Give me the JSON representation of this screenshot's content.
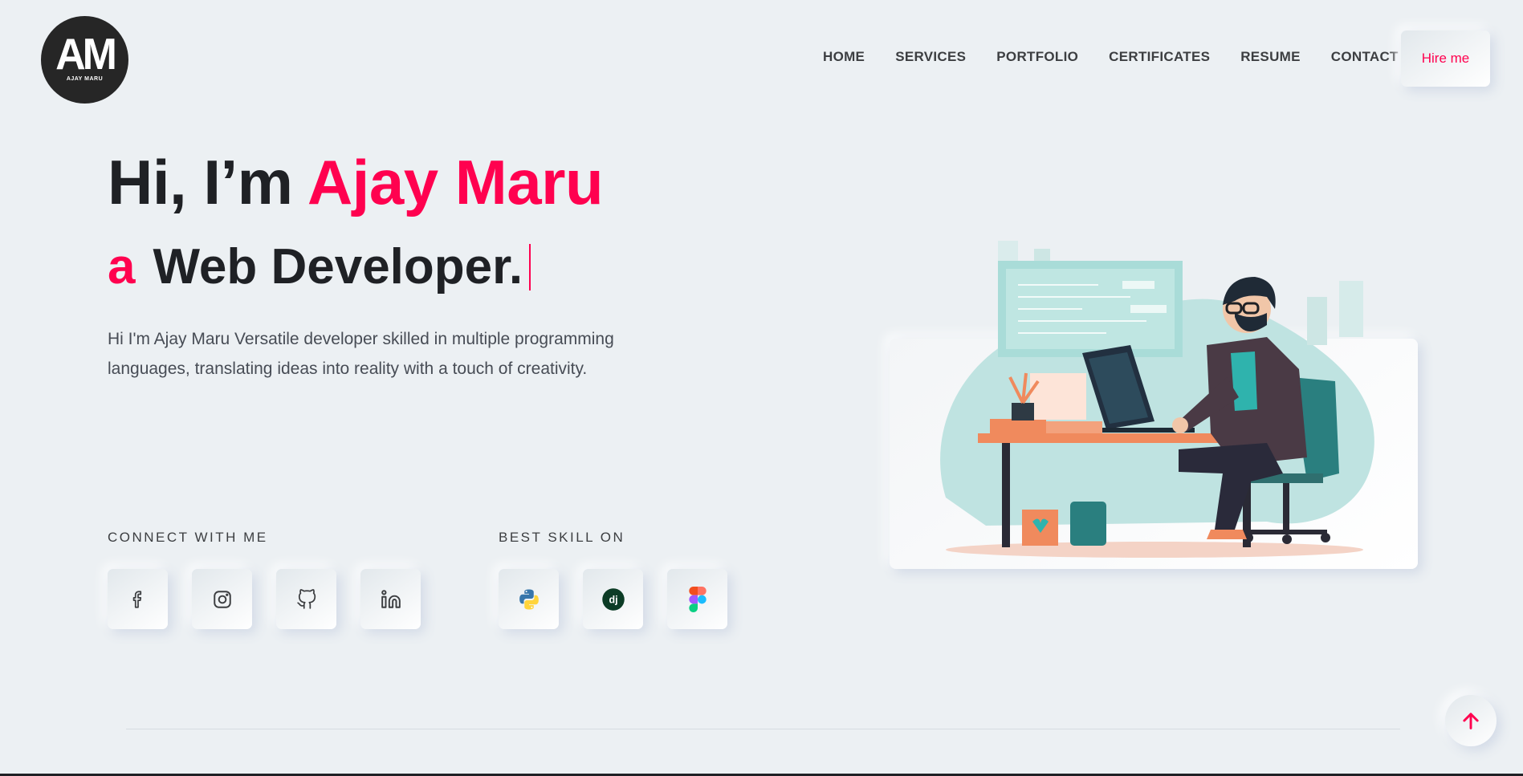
{
  "logo": {
    "mark": "AM",
    "subtitle": "AJAY MARU"
  },
  "nav": {
    "items": [
      "HOME",
      "SERVICES",
      "PORTFOLIO",
      "CERTIFICATES",
      "RESUME",
      "CONTACT"
    ],
    "hire_label": "Hire me"
  },
  "hero": {
    "greeting": "Hi, I’m ",
    "name": "Ajay Maru",
    "article": "a",
    "role": "Web Developer.",
    "description": "Hi I'm Ajay Maru Versatile developer skilled in multiple programming languages, translating ideas into reality with a touch of creativity."
  },
  "connect": {
    "label": "CONNECT WITH ME",
    "icons": [
      "facebook-icon",
      "instagram-icon",
      "github-icon",
      "linkedin-icon"
    ]
  },
  "skills": {
    "label": "BEST SKILL ON",
    "icons": [
      "python-icon",
      "django-icon",
      "figma-icon"
    ]
  },
  "colors": {
    "accent": "#ff014f",
    "background": "#ecf0f3",
    "heading": "#1f2125"
  }
}
